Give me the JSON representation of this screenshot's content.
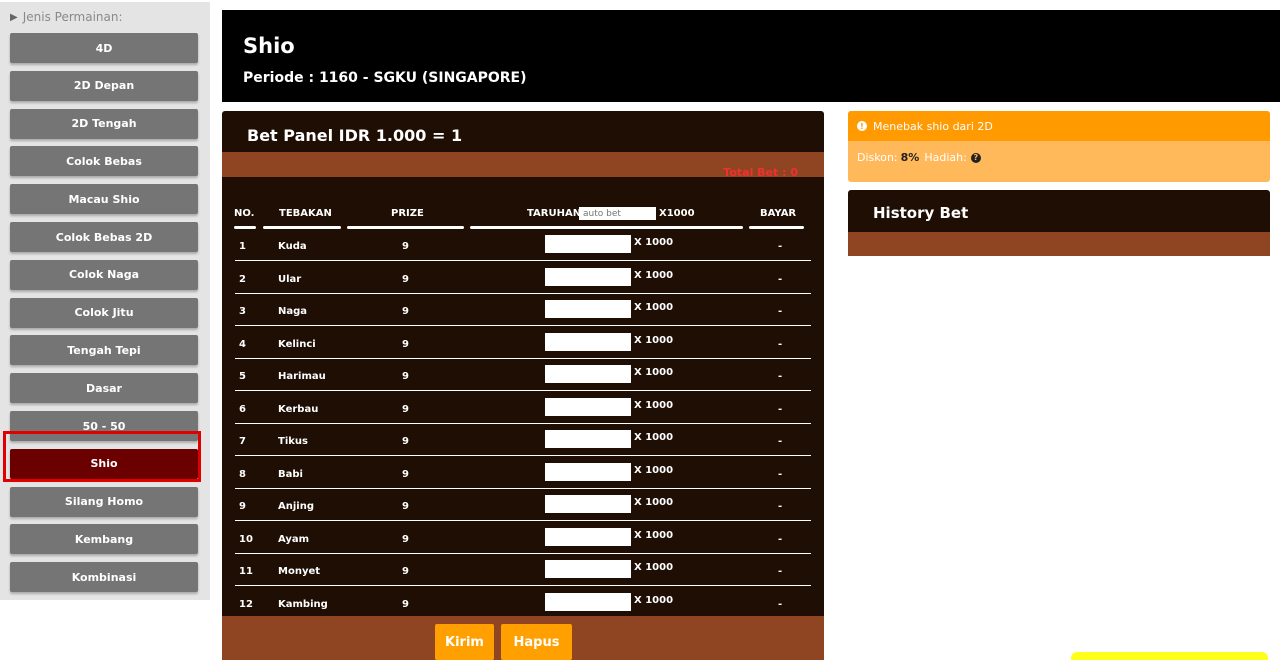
{
  "sidebar": {
    "heading": "Jenis Permainan:",
    "items": [
      {
        "label": "4D"
      },
      {
        "label": "2D Depan"
      },
      {
        "label": "2D Tengah"
      },
      {
        "label": "Colok Bebas"
      },
      {
        "label": "Macau Shio"
      },
      {
        "label": "Colok Bebas 2D"
      },
      {
        "label": "Colok Naga"
      },
      {
        "label": "Colok Jitu"
      },
      {
        "label": "Tengah Tepi"
      },
      {
        "label": "Dasar"
      },
      {
        "label": "50 - 50"
      },
      {
        "label": "Shio",
        "active": true
      },
      {
        "label": "Silang Homo"
      },
      {
        "label": "Kembang"
      },
      {
        "label": "Kombinasi"
      }
    ]
  },
  "header": {
    "title": "Shio",
    "period": "Periode : 1160 - SGKU (SINGAPORE)"
  },
  "panel": {
    "title": "Bet Panel IDR 1.000 = 1",
    "total_bet": "Total Bet : 0",
    "columns": {
      "no": "NO.",
      "tebakan": "TEBAKAN",
      "prize": "PRIZE",
      "taruhan": "TARUHAN",
      "autobet_placeholder": "auto bet",
      "x1000": "X1000",
      "bayar": "BAYAR"
    },
    "multiplier": "X 1000",
    "rows": [
      {
        "no": "1",
        "tebakan": "Kuda",
        "prize": "9",
        "bayar": "-"
      },
      {
        "no": "2",
        "tebakan": "Ular",
        "prize": "9",
        "bayar": "-"
      },
      {
        "no": "3",
        "tebakan": "Naga",
        "prize": "9",
        "bayar": "-"
      },
      {
        "no": "4",
        "tebakan": "Kelinci",
        "prize": "9",
        "bayar": "-"
      },
      {
        "no": "5",
        "tebakan": "Harimau",
        "prize": "9",
        "bayar": "-"
      },
      {
        "no": "6",
        "tebakan": "Kerbau",
        "prize": "9",
        "bayar": "-"
      },
      {
        "no": "7",
        "tebakan": "Tikus",
        "prize": "9",
        "bayar": "-"
      },
      {
        "no": "8",
        "tebakan": "Babi",
        "prize": "9",
        "bayar": "-"
      },
      {
        "no": "9",
        "tebakan": "Anjing",
        "prize": "9",
        "bayar": "-"
      },
      {
        "no": "10",
        "tebakan": "Ayam",
        "prize": "9",
        "bayar": "-"
      },
      {
        "no": "11",
        "tebakan": "Monyet",
        "prize": "9",
        "bayar": "-"
      },
      {
        "no": "12",
        "tebakan": "Kambing",
        "prize": "9",
        "bayar": "-"
      }
    ],
    "buttons": {
      "submit": "Kirim",
      "clear": "Hapus"
    }
  },
  "info": {
    "heading": "Menebak shio dari 2D",
    "discount_label": "Diskon:",
    "discount_value": "8%",
    "prize_label": "Hadiah:"
  },
  "history": {
    "title": "History Bet"
  },
  "colors": {
    "active_menu": "#6a0000",
    "accent_orange": "#ffa000",
    "panel_dark": "#1e0e04",
    "panel_brown": "#8f4522"
  }
}
